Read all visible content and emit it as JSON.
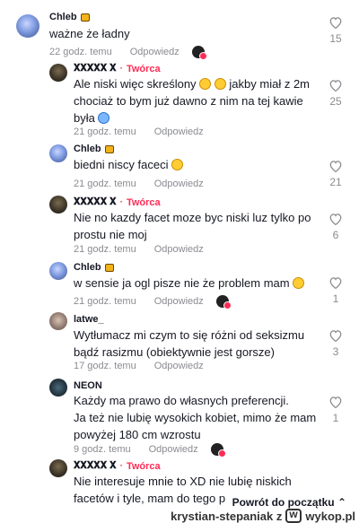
{
  "heart_icon": "heart-outline-icon",
  "colors": {
    "accent": "#fe2c55",
    "meta": "#8a8b91",
    "text": "#161823"
  },
  "comments": [
    {
      "author": "Chleb",
      "creator_label": "",
      "text_lines": [
        "ważne że ładny"
      ],
      "time": "22 godz. temu",
      "reply": "Odpowiedz",
      "likes": "15"
    },
    {
      "author": "𝐗𝐗𝐗𝐗𝐗 𝐗",
      "creator_label": "Twórca",
      "text_lines": [
        "Ale niski więc skreślony",
        "jakby miał z 2m",
        "chociaż to bym już dawno z nim na tej kawie",
        "była"
      ],
      "time": "21 godz. temu",
      "reply": "Odpowiedz",
      "likes": "25"
    },
    {
      "author": "Chleb",
      "creator_label": "",
      "text_lines": [
        "biedni niscy faceci"
      ],
      "time": "21 godz. temu",
      "reply": "Odpowiedz",
      "likes": "21"
    },
    {
      "author": "𝐗𝐗𝐗𝐗𝐗 𝐗",
      "creator_label": "Twórca",
      "text_lines": [
        "Nie no kazdy facet moze byc niski luz tylko po",
        "prostu nie moj"
      ],
      "time": "21 godz. temu",
      "reply": "Odpowiedz",
      "likes": "6"
    },
    {
      "author": "Chleb",
      "creator_label": "",
      "text_lines": [
        "w sensie ja ogl pisze nie że problem mam"
      ],
      "time": "21 godz. temu",
      "reply": "Odpowiedz",
      "likes": "1"
    },
    {
      "author": "latwe_",
      "creator_label": "",
      "text_lines": [
        "Wytłumacz mi czym to się różni od seksizmu",
        "bądź rasizmu (obiektywnie jest gorsze)"
      ],
      "time": "17 godz. temu",
      "reply": "Odpowiedz",
      "likes": "3"
    },
    {
      "author": "NEON",
      "creator_label": "",
      "text_lines": [
        "Każdy ma prawo do własnych preferencji.",
        "Ja też nie lubię wysokich kobiet, mimo że mam",
        "powyżej 180 cm wzrostu"
      ],
      "time": "9 godz. temu",
      "reply": "Odpowiedz",
      "likes": "1"
    },
    {
      "author": "𝐗𝐗𝐗𝐗𝐗 𝐗",
      "creator_label": "Twórca",
      "text_lines": [
        "Nie interesuje mnie to XD nie lubię niskich",
        "facetów i tyle, mam do tego p"
      ],
      "time": "",
      "reply": "",
      "likes": ""
    }
  ],
  "footer": {
    "back_to_top": "Powrót do początku",
    "back_arrow": "⌃",
    "watermark": "krystian-stepaniak z",
    "site": "wykop.pl"
  }
}
